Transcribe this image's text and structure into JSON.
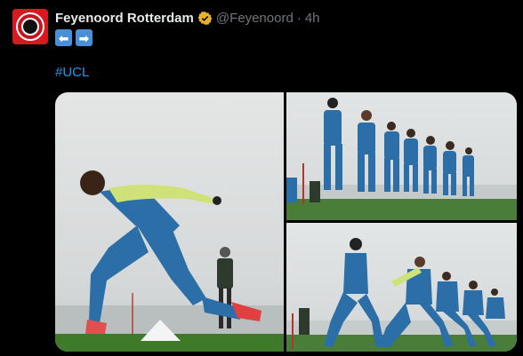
{
  "tweet": {
    "display_name": "Feyenoord Rotterdam",
    "handle": "@Feyenoord",
    "separator": "·",
    "time": "4h",
    "arrows": [
      "⬅",
      "➡"
    ],
    "hashtag": "#UCL",
    "avatar_icon": "feyenoord-crest-icon",
    "verified_icon": "verified-gold-badge-icon"
  },
  "colors": {
    "background": "#000000",
    "name": "#e7e9ea",
    "muted": "#71767b",
    "link": "#1d9bf0",
    "verified": "#e8b22a",
    "arrow_button": "#4a90d9"
  },
  "media": {
    "photos": [
      "training-player-lunging-photo",
      "players-jogging-line-photo",
      "players-running-group-photo"
    ]
  }
}
